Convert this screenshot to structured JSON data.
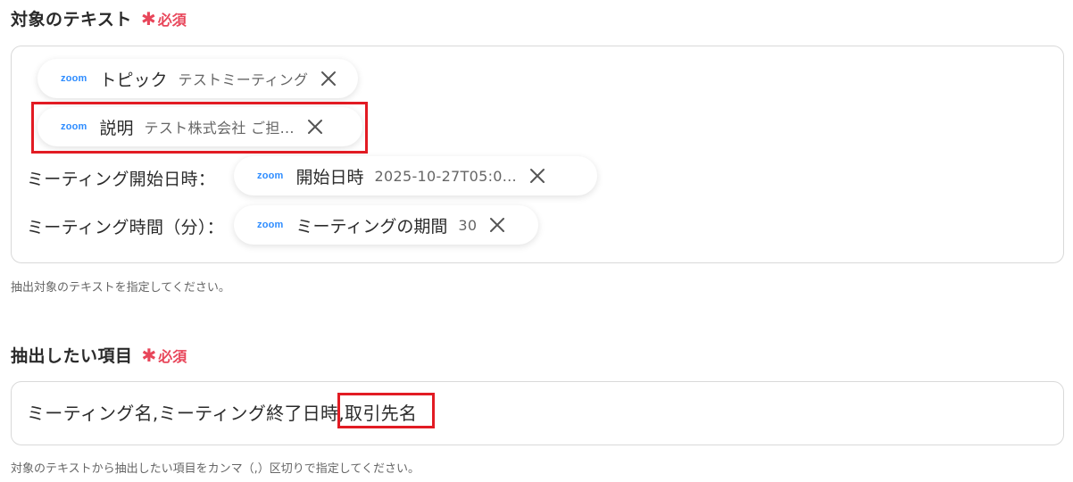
{
  "section1": {
    "label": "対象のテキスト",
    "required_mark": "✱",
    "required_label": "必須",
    "pills": [
      {
        "source": "zoom",
        "name": "トピック",
        "value": "テストミーティング"
      },
      {
        "source": "zoom",
        "name": "説明",
        "value": "テスト株式会社 ご担..."
      },
      {
        "source": "zoom",
        "name": "開始日時",
        "value": "2025-10-27T05:0..."
      },
      {
        "source": "zoom",
        "name": "ミーティングの期間",
        "value": "30"
      }
    ],
    "row_labels": [
      "ミーティング開始日時：",
      "ミーティング時間（分）："
    ],
    "help": "抽出対象のテキストを指定してください。"
  },
  "section2": {
    "label": "抽出したい項目",
    "required_mark": "✱",
    "required_label": "必須",
    "value_part1": "ミーティング名,ミーティング終了日時",
    "value_part2": ",取引先名",
    "help": "対象のテキストから抽出したい項目をカンマ（,）区切りで指定してください。"
  },
  "colors": {
    "required": "#e8465a",
    "highlight": "#e21b23",
    "zoom_brand": "#2d8cff"
  }
}
